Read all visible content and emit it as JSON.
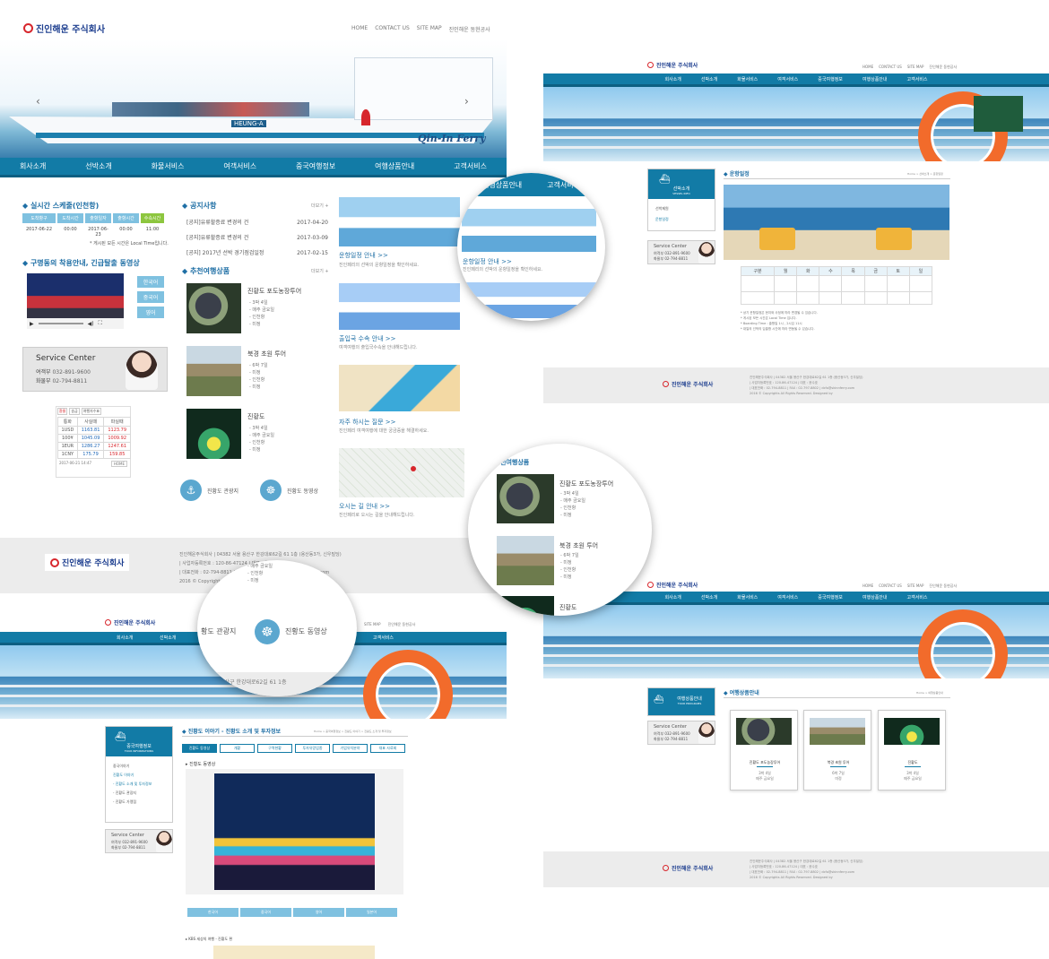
{
  "brand": {
    "logo_text": "진인해운 주식회사",
    "logo_text_small": "진인해운 주식회사",
    "ferry_name": "Qin-In Ferry",
    "ship_text": "HEUNG-A"
  },
  "top_links": [
    "HOME",
    "CONTACT US",
    "SITE MAP",
    "진인해운 동현공사"
  ],
  "gnb": [
    "회사소개",
    "선박소개",
    "화물서비스",
    "여객서비스",
    "중국여행정보",
    "여행상품안내",
    "고객서비스"
  ],
  "schedule": {
    "title": "실시간 스케줄(인천항)",
    "headers": [
      "도착항구",
      "도착시간",
      "출항일자",
      "출항시간",
      "수속시간"
    ],
    "row": [
      "2017-06-22",
      "00:00",
      "2017-06-23",
      "00:00",
      "11:00"
    ],
    "note": "* 게시된 모든 시간은 Local Time입니다."
  },
  "notice": {
    "title": "공지사항",
    "more": "더보기 +",
    "items": [
      {
        "text": "[공지]유류할증료 변경의 건",
        "date": "2017-04-20"
      },
      {
        "text": "[공지]유류할증료 변경의 건",
        "date": "2017-03-09"
      },
      {
        "text": "[공지] 2017년 선박 경기점검일정",
        "date": "2017-02-15"
      }
    ]
  },
  "video": {
    "title": "구명동의 착용안내, 긴급탈출 동영상",
    "langs": [
      "한국어",
      "중국어",
      "영어"
    ]
  },
  "service_center": {
    "title": "Service Center",
    "rows": [
      {
        "label": "여객부",
        "value": "032-891-9600"
      },
      {
        "label": "화물부",
        "value": "02-794-8811"
      }
    ]
  },
  "exchange": {
    "tabs": [
      "환율",
      "송금",
      "여행자수표"
    ],
    "headers": [
      "통화",
      "사실때",
      "파실때"
    ],
    "rows": [
      [
        "1USD",
        "1163.81",
        "1123.79"
      ],
      [
        "100¥",
        "1045.09",
        "1009.92"
      ],
      [
        "1EUR",
        "1286.27",
        "1247.61"
      ],
      [
        "1CNY",
        "175.79",
        "159.85"
      ]
    ],
    "date": "2017-06-21 14:47",
    "home_btn": "HOME"
  },
  "tours": {
    "title": "추천여행상품",
    "more": "더보기 +",
    "items": [
      {
        "name": "진황도 포도농장투어",
        "details": [
          "- 3박 4일",
          "- 매주 금요일",
          "- 인천항",
          "- 미정"
        ]
      },
      {
        "name": "북경 초원 투어",
        "details": [
          "- 6박 7일",
          "- 미정",
          "- 인천항",
          "- 미정"
        ]
      },
      {
        "name": "진황도",
        "details": [
          "- 3박 4일",
          "- 매주 금요일",
          "- 인천항",
          "- 미정"
        ]
      }
    ]
  },
  "quick_links": [
    "진황도 관광지",
    "진황도 동영상"
  ],
  "promos": [
    {
      "title": "운항일정 안내 >>",
      "desc": "진인페리의 선박의 운항일정을 확인하세요."
    },
    {
      "title": "출입국 수속 안내 >>",
      "desc": "여객여행의 출입국수속을 안내해드립니다."
    },
    {
      "title": "자주 하시는 질문 >>",
      "desc": "진인페리 여객여행에 대한 궁금증을 해결하세요."
    },
    {
      "title": "오시는 길 안내 >>",
      "desc": "진인페리로 오시는 길을 안내해드립니다."
    }
  ],
  "footer": {
    "lines": [
      "진인해운주식회사 | 04382 서울 용산구 한강대로62길 61 1층 (용산동3가, 신우빌딩)",
      "| 사업자등록번호 : 120-86-47124 | 대표 : 윤수호",
      "| 대표전화 : 02-794-8811 | FAX : 02-797-8802 | dcfo@skinnferry.com",
      "2016 © Copyrights All Rights Reserved. Designed by"
    ]
  },
  "zoom_callouts": {
    "menu": [
      "여행상품안내",
      "고객서비"
    ],
    "promo_title": "운항일정 안내 >>",
    "promo_desc": "진인페리의 선박의 운항일정을 확인하세요.",
    "tour_title": "선여행상품",
    "tours": [
      {
        "name": "진황도 포도농장투어",
        "details": [
          "- 3박 4일",
          "- 매주 금요일",
          "- 인천항",
          "- 미정"
        ]
      },
      {
        "name": "북경 초원 투어",
        "details": [
          "- 6박 7일",
          "- 미정",
          "- 인천항",
          "- 미정"
        ]
      },
      {
        "name": "진황도"
      }
    ],
    "quick": [
      "황도 관광지",
      "진황도 동영상"
    ],
    "addr": "용산구 한강대로62길 61 1층"
  },
  "page_schedule": {
    "lnb_title": "선박소개",
    "lnb_sub": "VESSEL INFO",
    "lnb_items": [
      "선박제원",
      "운항일정"
    ],
    "heading": "운항일정",
    "breadcrumb": "Home > 선박소개 > 운항일정",
    "days": [
      "구분",
      "월",
      "화",
      "수",
      "목",
      "금",
      "토",
      "일"
    ],
    "notes": [
      "* 상기 운항일정은 현지와 사정에 따라 변경될 수 있습니다.",
      "* 게시된 모든 시간은 Local Time 입니다.",
      "* Boarding Time : 출항일 1시 , 2시입 11시",
      "* 대일의 선박의 입출항 시간에 따라 변동될 수 있습니다."
    ]
  },
  "page_tour": {
    "lnb_title": "중국여행정보",
    "lnb_sub": "TOUR INFORMATIONS",
    "lnb_items": [
      "중국이야기",
      "진황도 이야기",
      "- 진황도 소개 및 투자정보",
      "- 진황도 관광지",
      "- 진황도 가맹점"
    ],
    "heading": "진황도 이야기 - 진황도 소개 및 투자정보",
    "breadcrumb": "Home > 중국여행정보 > 진황도 이야기 > 진황도 소개 및 투자정보",
    "tabs": [
      "진황도 동영상",
      "개황",
      "구역현황",
      "투자유망업종",
      "기업유치분야",
      "대표 사료회"
    ],
    "section": "▸ 진황도 동영상",
    "video_btns": [
      "한국어",
      "중국어",
      "영어",
      "일본어"
    ],
    "section2": "▸ KBS 세상의 여행 - 진황도 편"
  },
  "page_products": {
    "lnb_title": "여행상품안내",
    "lnb_sub": "TOUR PROGRAMS",
    "heading": "여행상품안내",
    "breadcrumb": "Home > 여행상품안내",
    "cards": [
      {
        "name": "진황도 포도농장투어",
        "line1": "3박 4일",
        "line2": "매주 금요일"
      },
      {
        "name": "북경 초원 투어",
        "line1": "6박 7일",
        "line2": "미정"
      },
      {
        "name": "진황도",
        "line1": "3박 4일",
        "line2": "매주 금요일"
      }
    ]
  },
  "colors": {
    "primary": "#127ba6",
    "accent": "#d7262c",
    "light_btn": "#7fc1e0"
  }
}
